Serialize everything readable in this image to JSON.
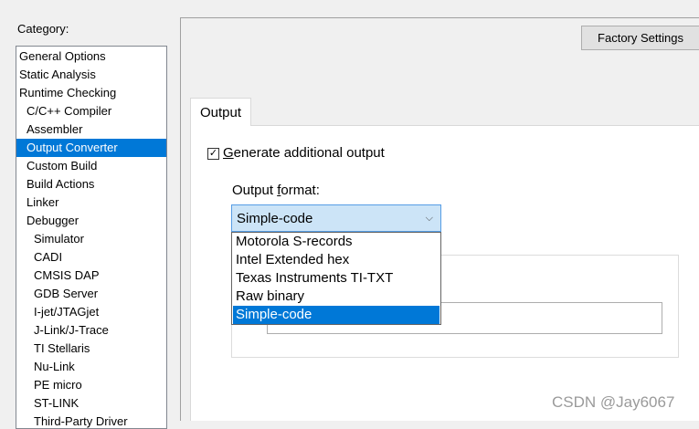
{
  "category": {
    "label": "Category:",
    "items": [
      {
        "label": "General Options",
        "indent": 0
      },
      {
        "label": "Static Analysis",
        "indent": 0
      },
      {
        "label": "Runtime Checking",
        "indent": 0
      },
      {
        "label": "C/C++ Compiler",
        "indent": 1
      },
      {
        "label": "Assembler",
        "indent": 1
      },
      {
        "label": "Output Converter",
        "indent": 1
      },
      {
        "label": "Custom Build",
        "indent": 1
      },
      {
        "label": "Build Actions",
        "indent": 1
      },
      {
        "label": "Linker",
        "indent": 1
      },
      {
        "label": "Debugger",
        "indent": 1
      },
      {
        "label": "Simulator",
        "indent": 2
      },
      {
        "label": "CADI",
        "indent": 2
      },
      {
        "label": "CMSIS DAP",
        "indent": 2
      },
      {
        "label": "GDB Server",
        "indent": 2
      },
      {
        "label": "I-jet/JTAGjet",
        "indent": 2
      },
      {
        "label": "J-Link/J-Trace",
        "indent": 2
      },
      {
        "label": "TI Stellaris",
        "indent": 2
      },
      {
        "label": "Nu-Link",
        "indent": 2
      },
      {
        "label": "PE micro",
        "indent": 2
      },
      {
        "label": "ST-LINK",
        "indent": 2
      },
      {
        "label": "Third-Party Driver",
        "indent": 2
      }
    ],
    "selected_index": 5
  },
  "header": {
    "factory_settings": "Factory Settings"
  },
  "tabs": [
    {
      "label": "Output"
    }
  ],
  "output": {
    "generate_checked": true,
    "generate_mnemonic": "G",
    "generate_rest": "enerate additional output",
    "format_label_pre": "Output ",
    "format_label_mnemonic": "f",
    "format_label_post": "ormat:",
    "format_value": "Simple-code",
    "format_options": [
      "Motorola S-records",
      "Intel Extended hex",
      "Texas Instruments TI-TXT",
      "Raw binary",
      "Simple-code"
    ],
    "format_selected_index": 4
  },
  "watermark": "CSDN @Jay6067",
  "colors": {
    "selection": "#0078d7",
    "combo_highlight": "#cce4f7"
  }
}
